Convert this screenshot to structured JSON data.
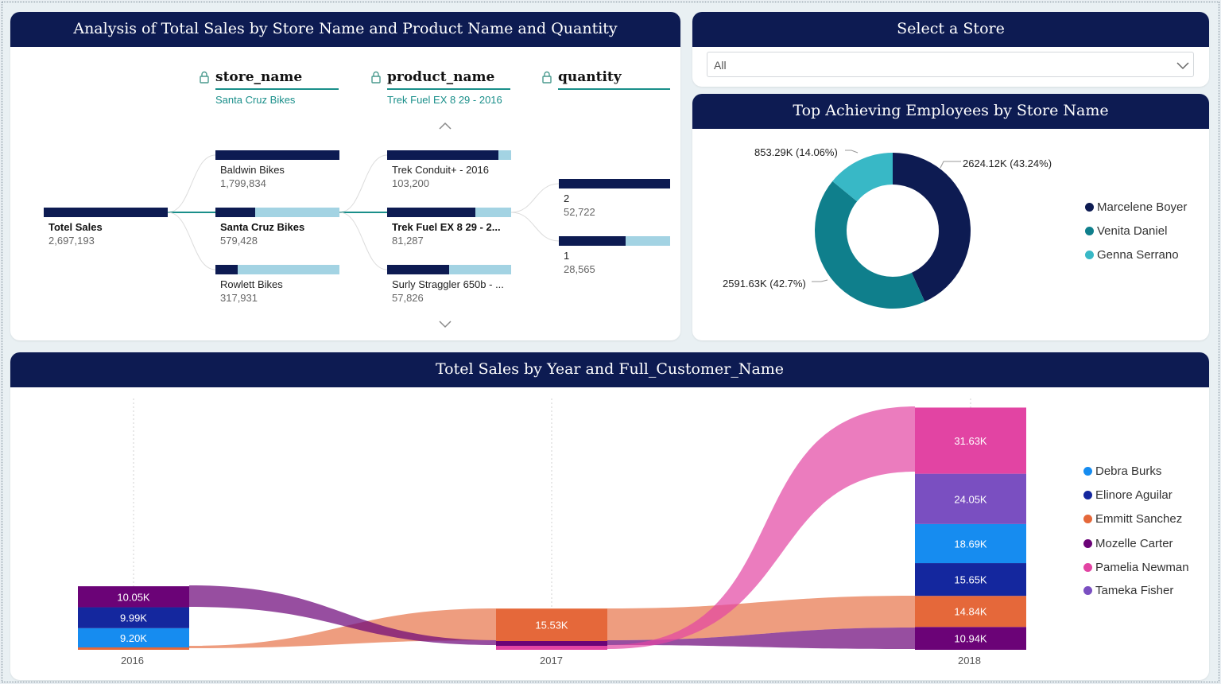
{
  "decomp": {
    "title": "Analysis of Total Sales by Store Name and Product Name and Quantity",
    "headers": [
      "store_name",
      "product_name",
      "quantity"
    ],
    "crumbs": [
      "Santa Cruz Bikes",
      "Trek Fuel EX 8 29 - 2016"
    ],
    "root": {
      "label": "Totel Sales",
      "value": "2,697,193"
    },
    "stores": [
      {
        "label": "Baldwin Bikes",
        "value": "1,799,834",
        "fill": 1.0
      },
      {
        "label": "Santa Cruz Bikes",
        "value": "579,428",
        "fill": 0.32
      },
      {
        "label": "Rowlett Bikes",
        "value": "317,931",
        "fill": 0.18
      }
    ],
    "products": [
      {
        "label": "Trek Conduit+ - 2016",
        "value": "103,200",
        "fill": 0.9
      },
      {
        "label": "Trek Fuel EX 8 29 - 2...",
        "value": "81,287",
        "fill": 0.71
      },
      {
        "label": "Surly Straggler 650b - ...",
        "value": "57,826",
        "fill": 0.5
      }
    ],
    "quantities": [
      {
        "label": "2",
        "value": "52,722",
        "fill": 1.0
      },
      {
        "label": "1",
        "value": "28,565",
        "fill": 0.6
      }
    ]
  },
  "slicer": {
    "title": "Select a Store",
    "selected": "All"
  },
  "donut": {
    "title": "Top Achieving Employees by Store Name",
    "legend": [
      {
        "name": "Marcelene Boyer",
        "color": "#0d1b52"
      },
      {
        "name": "Venita Daniel",
        "color": "#0f7f8c"
      },
      {
        "name": "Genna Serrano",
        "color": "#38b8c6"
      }
    ],
    "slice_labels": [
      "2624.12K (43.24%)",
      "2591.63K (42.7%)",
      "853.29K (14.06%)"
    ]
  },
  "ribbon": {
    "title": "Totel Sales by Year and Full_Customer_Name",
    "legend": [
      {
        "name": "Debra Burks",
        "color": "#168cf0"
      },
      {
        "name": "Elinore Aguilar",
        "color": "#14279e"
      },
      {
        "name": "Emmitt Sanchez",
        "color": "#e5683a"
      },
      {
        "name": "Mozelle Carter",
        "color": "#6b0377"
      },
      {
        "name": "Pamelia Newman",
        "color": "#e244a3"
      },
      {
        "name": "Tameka Fisher",
        "color": "#7a4fc1"
      }
    ]
  },
  "chart_data": {
    "type": "bar",
    "title": "Totel Sales by Year and Full_Customer_Name",
    "categories": [
      "2016",
      "2017",
      "2018"
    ],
    "series": [
      {
        "name": "Debra Burks",
        "values": [
          9.2,
          null,
          18.69
        ]
      },
      {
        "name": "Elinore Aguilar",
        "values": [
          9.99,
          null,
          15.65
        ]
      },
      {
        "name": "Emmitt Sanchez",
        "values": [
          null,
          15.53,
          14.84
        ]
      },
      {
        "name": "Mozelle Carter",
        "values": [
          10.05,
          null,
          10.94
        ]
      },
      {
        "name": "Pamelia Newman",
        "values": [
          null,
          null,
          31.63
        ]
      },
      {
        "name": "Tameka Fisher",
        "values": [
          null,
          null,
          24.05
        ]
      }
    ],
    "segment_labels": {
      "2016": [
        "10.05K",
        "9.99K",
        "9.20K"
      ],
      "2017": [
        "15.53K"
      ],
      "2018": [
        "31.63K",
        "24.05K",
        "18.69K",
        "15.65K",
        "14.84K",
        "10.94K"
      ]
    },
    "units": "K",
    "legend": "right"
  }
}
